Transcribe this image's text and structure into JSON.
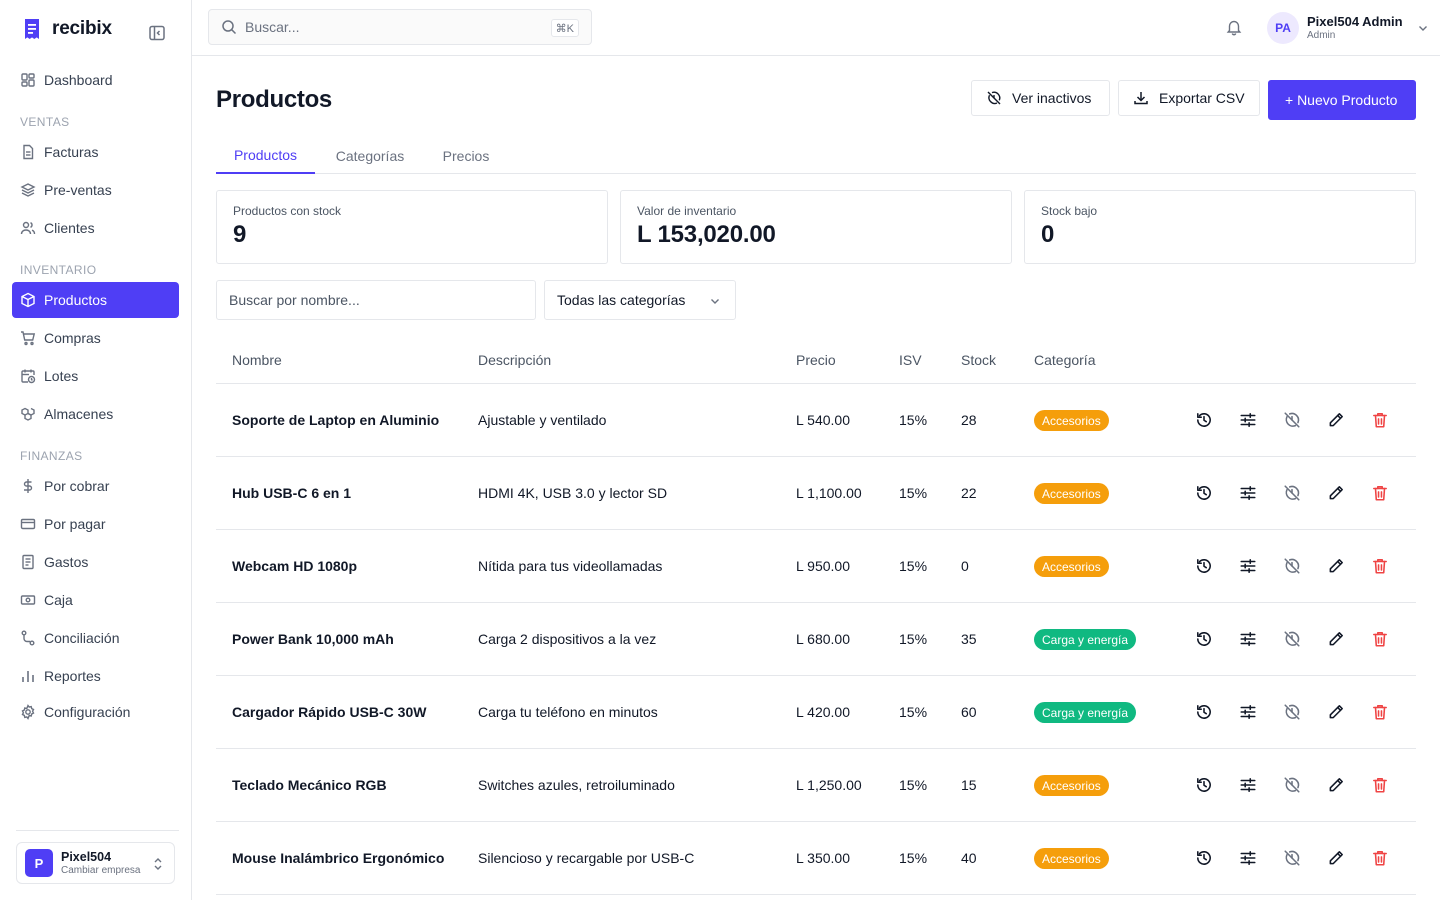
{
  "brand": {
    "name": "recibix",
    "color": "#4f3ef5"
  },
  "sidebar": {
    "items_top": [
      {
        "label": "Dashboard",
        "icon": "dashboard-icon"
      }
    ],
    "sections": [
      {
        "title": "VENTAS",
        "items": [
          {
            "label": "Facturas",
            "icon": "file-icon"
          },
          {
            "label": "Pre-ventas",
            "icon": "layers-icon"
          },
          {
            "label": "Clientes",
            "icon": "users-icon"
          }
        ]
      },
      {
        "title": "INVENTARIO",
        "items": [
          {
            "label": "Productos",
            "icon": "box-icon",
            "active": true
          },
          {
            "label": "Compras",
            "icon": "cart-icon"
          },
          {
            "label": "Lotes",
            "icon": "calendar-clock-icon"
          },
          {
            "label": "Almacenes",
            "icon": "warehouse-icon"
          }
        ]
      },
      {
        "title": "FINANZAS",
        "items": [
          {
            "label": "Por cobrar",
            "icon": "dollar-icon"
          },
          {
            "label": "Por pagar",
            "icon": "credit-card-icon"
          },
          {
            "label": "Gastos",
            "icon": "receipt-icon"
          },
          {
            "label": "Caja",
            "icon": "cash-icon"
          },
          {
            "label": "Conciliación",
            "icon": "route-icon"
          },
          {
            "label": "Reportes",
            "icon": "bar-chart-icon"
          },
          {
            "label": "Configuración",
            "icon": "gear-icon"
          }
        ]
      }
    ],
    "company": {
      "initial": "P",
      "name": "Pixel504",
      "subtitle": "Cambiar empresa"
    }
  },
  "topbar": {
    "search_placeholder": "Buscar...",
    "shortcut": "⌘K",
    "user": {
      "initials": "PA",
      "name": "Pixel504 Admin",
      "role": "Admin"
    }
  },
  "page": {
    "title": "Productos",
    "actions": {
      "inactive": "Ver inactivos",
      "export": "Exportar CSV",
      "new": "+ Nuevo Producto"
    },
    "tabs": [
      "Productos",
      "Categorías",
      "Precios"
    ],
    "active_tab": "Productos"
  },
  "stats": [
    {
      "label": "Productos con stock",
      "value": "9"
    },
    {
      "label": "Valor de inventario",
      "value": "L 153,020.00"
    },
    {
      "label": "Stock bajo",
      "value": "0"
    }
  ],
  "filters": {
    "search_placeholder": "Buscar por nombre...",
    "category": "Todas las categorías"
  },
  "table": {
    "columns": [
      "Nombre",
      "Descripción",
      "Precio",
      "ISV",
      "Stock",
      "Categoría"
    ],
    "rows": [
      {
        "name": "Soporte de Laptop en Aluminio",
        "description": "Ajustable y ventilado",
        "price": "L 540.00",
        "isv": "15%",
        "stock": "28",
        "category": "Accesorios",
        "category_color": "#f59e0b"
      },
      {
        "name": "Hub USB-C 6 en 1",
        "description": "HDMI 4K, USB 3.0 y lector SD",
        "price": "L 1,100.00",
        "isv": "15%",
        "stock": "22",
        "category": "Accesorios",
        "category_color": "#f59e0b"
      },
      {
        "name": "Webcam HD 1080p",
        "description": "Nítida para tus videollamadas",
        "price": "L 950.00",
        "isv": "15%",
        "stock": "0",
        "category": "Accesorios",
        "category_color": "#f59e0b"
      },
      {
        "name": "Power Bank 10,000 mAh",
        "description": "Carga 2 dispositivos a la vez",
        "price": "L 680.00",
        "isv": "15%",
        "stock": "35",
        "category": "Carga y energía",
        "category_color": "#10b981"
      },
      {
        "name": "Cargador Rápido USB-C 30W",
        "description": "Carga tu teléfono en minutos",
        "price": "L 420.00",
        "isv": "15%",
        "stock": "60",
        "category": "Carga y energía",
        "category_color": "#10b981"
      },
      {
        "name": "Teclado Mecánico RGB",
        "description": "Switches azules, retroiluminado",
        "price": "L 1,250.00",
        "isv": "15%",
        "stock": "15",
        "category": "Accesorios",
        "category_color": "#f59e0b"
      },
      {
        "name": "Mouse Inalámbrico Ergonómico",
        "description": "Silencioso y recargable por USB-C",
        "price": "L 350.00",
        "isv": "15%",
        "stock": "40",
        "category": "Accesorios",
        "category_color": "#f59e0b"
      }
    ],
    "row_actions": [
      "history-icon",
      "sliders-icon",
      "deactivate-icon",
      "edit-icon",
      "trash-icon"
    ]
  }
}
